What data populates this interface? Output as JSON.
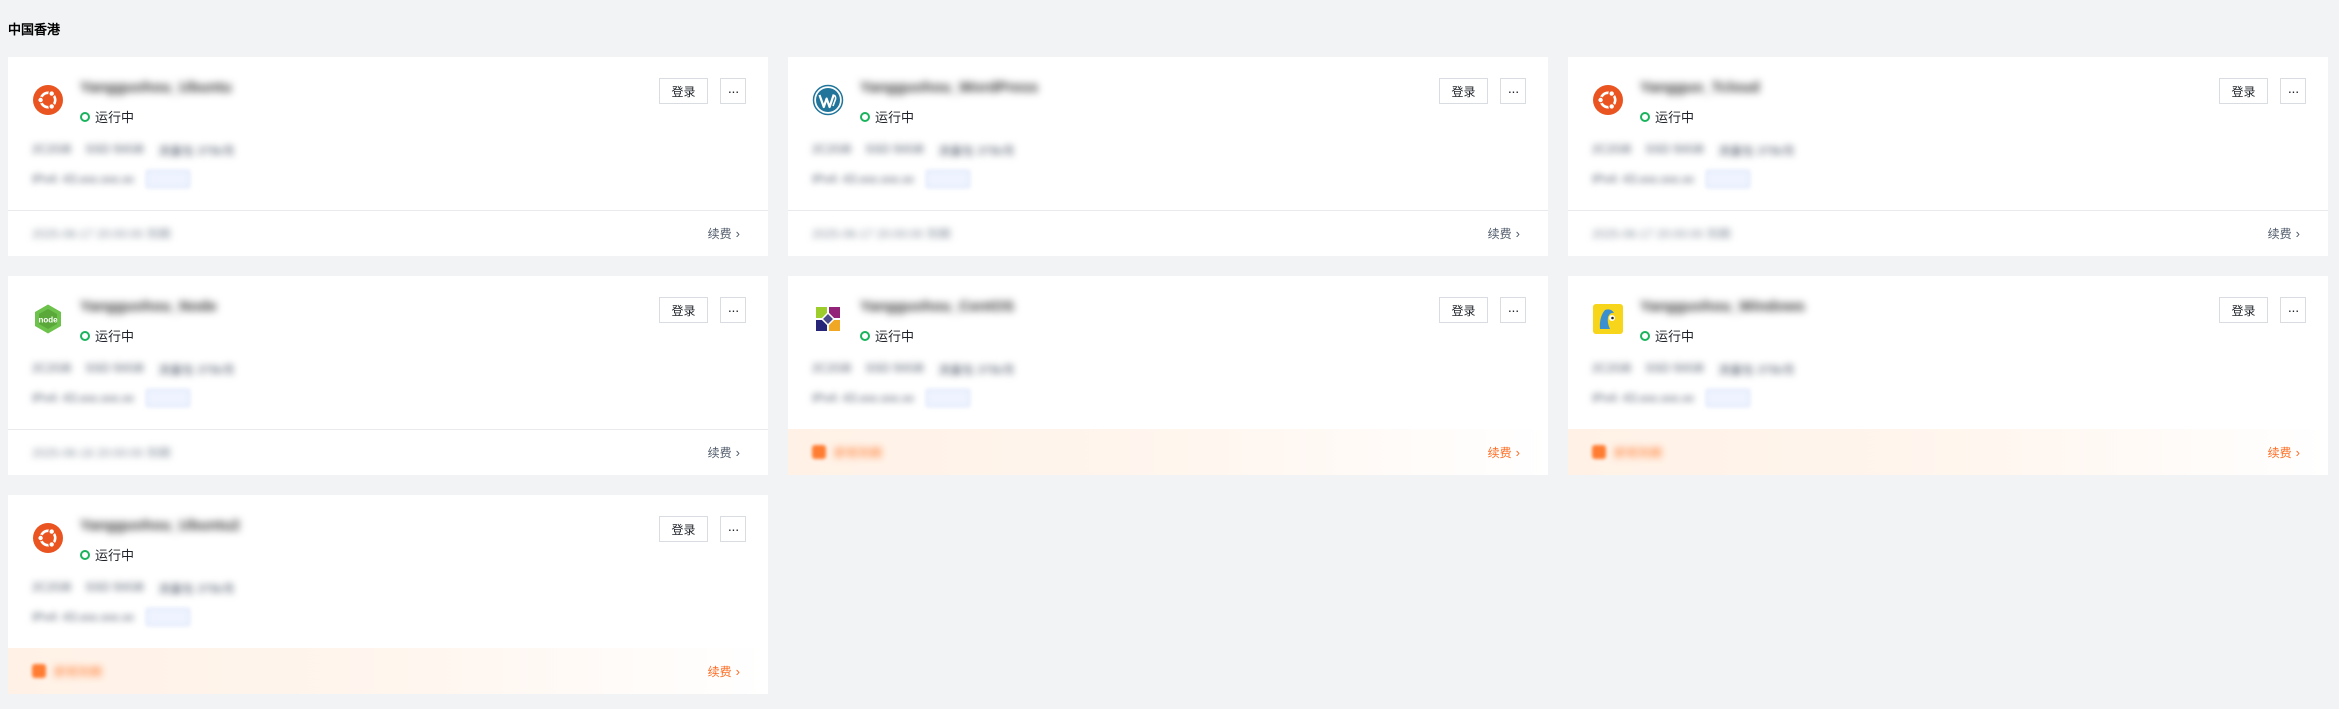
{
  "region_title": "中国香港",
  "buttons": {
    "login": "登录",
    "more": "···",
    "renew": "续费",
    "renew_arrow": "›"
  },
  "instances": [
    {
      "os_icon": "ubuntu-icon",
      "name": "Yangguohou_Ubuntu",
      "status": "运行中",
      "spec": [
        "2C2GB",
        "SSD 50GB",
        "流量包 3TB/月"
      ],
      "ip": "IPv4: 43.xxx.xxx.xx",
      "footer_type": "normal",
      "expiry": "2025-06-17 20:00:00 到期"
    },
    {
      "os_icon": "wordpress-icon",
      "name": "Yangguohou_WordPress",
      "status": "运行中",
      "spec": [
        "2C2GB",
        "SSD 50GB",
        "流量包 3TB/月"
      ],
      "ip": "IPv4: 43.xxx.xxx.xx",
      "footer_type": "normal",
      "expiry": "2025-06-17 20:00:00 到期"
    },
    {
      "os_icon": "ubuntu-icon",
      "name": "Yangguo_Tcloud",
      "status": "运行中",
      "spec": [
        "2C2GB",
        "SSD 50GB",
        "流量包 3TB/月"
      ],
      "ip": "IPv4: 43.xxx.xxx.xx",
      "footer_type": "normal",
      "expiry": "2025-06-17 20:00:00 到期"
    },
    {
      "os_icon": "nodejs-icon",
      "name": "Yangguohou_Node",
      "status": "运行中",
      "spec": [
        "2C2GB",
        "SSD 50GB",
        "流量包 3TB/月"
      ],
      "ip": "IPv4: 43.xxx.xxx.xx",
      "footer_type": "normal",
      "expiry": "2025-06-18 20:00:00 到期"
    },
    {
      "os_icon": "centos-icon",
      "name": "Yangguohou_CentOS",
      "status": "运行中",
      "spec": [
        "2C2GB",
        "SSD 50GB",
        "流量包 3TB/月"
      ],
      "ip": "IPv4: 43.xxx.xxx.xx",
      "footer_type": "warn",
      "warn_text": "即将到期"
    },
    {
      "os_icon": "windows-icon",
      "name": "Yangguohou_Windows",
      "status": "运行中",
      "spec": [
        "2C2GB",
        "SSD 50GB",
        "流量包 3TB/月"
      ],
      "ip": "IPv4: 43.xxx.xxx.xx",
      "footer_type": "warn",
      "warn_text": "即将到期"
    },
    {
      "os_icon": "ubuntu-icon",
      "name": "Yangguohou_Ubuntu2",
      "status": "运行中",
      "spec": [
        "2C2GB",
        "SSD 50GB",
        "流量包 3TB/月"
      ],
      "ip": "IPv4: 43.xxx.xxx.xx",
      "footer_type": "warn",
      "warn_text": "即将到期"
    }
  ],
  "colors": {
    "status_running": "#1ab35d",
    "warning": "#ff7d33",
    "ubuntu": "#e95420",
    "wordpress": "#21759b",
    "nodejs": "#6cc24a"
  }
}
